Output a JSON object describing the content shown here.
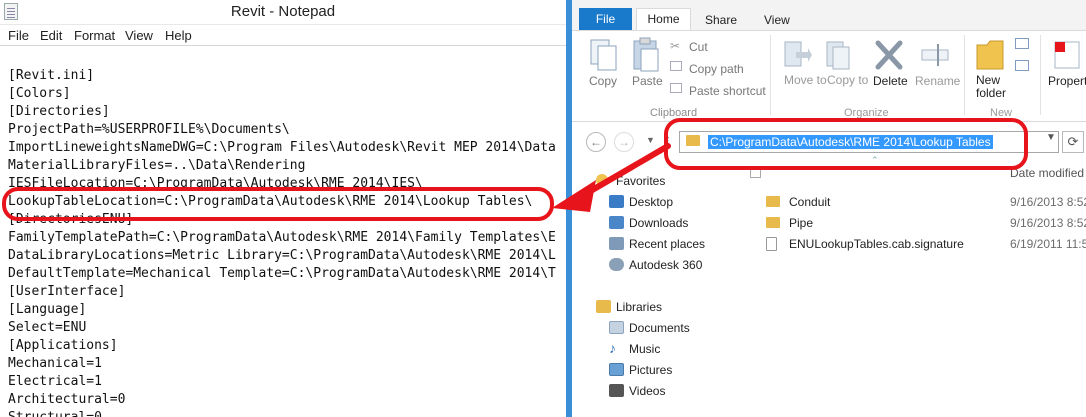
{
  "notepad": {
    "title": "Revit - Notepad",
    "menu": [
      "File",
      "Edit",
      "Format",
      "View",
      "Help"
    ],
    "lines": [
      "[Revit.ini]",
      "[Colors]",
      "[Directories]",
      "ProjectPath=%USERPROFILE%\\Documents\\",
      "ImportLineweightsNameDWG=C:\\Program Files\\Autodesk\\Revit MEP 2014\\Data",
      "MaterialLibraryFiles=..\\Data\\Rendering",
      "IESFileLocation=C:\\ProgramData\\Autodesk\\RME 2014\\IES\\",
      "LookupTableLocation=C:\\ProgramData\\Autodesk\\RME 2014\\Lookup Tables\\",
      "[DirectoriesENU]",
      "FamilyTemplatePath=C:\\ProgramData\\Autodesk\\RME 2014\\Family Templates\\E",
      "DataLibraryLocations=Metric Library=C:\\ProgramData\\Autodesk\\RME 2014\\L",
      "DefaultTemplate=Mechanical Template=C:\\ProgramData\\Autodesk\\RME 2014\\T",
      "[UserInterface]",
      "[Language]",
      "Select=ENU",
      "[Applications]",
      "Mechanical=1",
      "Electrical=1",
      "Architectural=0",
      "Structural=0"
    ]
  },
  "explorer": {
    "tabs": {
      "file": "File",
      "home": "Home",
      "share": "Share",
      "view": "View"
    },
    "ribbon": {
      "copy": "Copy",
      "paste": "Paste",
      "cut": "Cut",
      "copy_path": "Copy path",
      "paste_shortcut": "Paste shortcut",
      "clipboard_group": "Clipboard",
      "move_to": "Move to",
      "copy_to": "Copy to",
      "delete": "Delete",
      "rename": "Rename",
      "organize_group": "Organize",
      "new_folder": "New folder",
      "new_group": "New",
      "properties": "Propert"
    },
    "address": "C:\\ProgramData\\Autodesk\\RME 2014\\Lookup Tables",
    "columns": {
      "date_modified": "Date modified"
    },
    "nav": {
      "favorites": "Favorites",
      "desktop": "Desktop",
      "downloads": "Downloads",
      "recent": "Recent places",
      "autodesk360": "Autodesk 360",
      "libraries": "Libraries",
      "documents": "Documents",
      "music": "Music",
      "pictures": "Pictures",
      "videos": "Videos"
    },
    "files": [
      {
        "name": "Conduit",
        "date": "9/16/2013 8:52",
        "kind": "folder"
      },
      {
        "name": "Pipe",
        "date": "9/16/2013 8:52",
        "kind": "folder"
      },
      {
        "name": "ENULookupTables.cab.signature",
        "date": "6/19/2011 11:5",
        "kind": "file"
      }
    ],
    "colors": {
      "accent": "#1979ca",
      "selection": "#3399ff",
      "annotation": "#e8141b"
    }
  }
}
